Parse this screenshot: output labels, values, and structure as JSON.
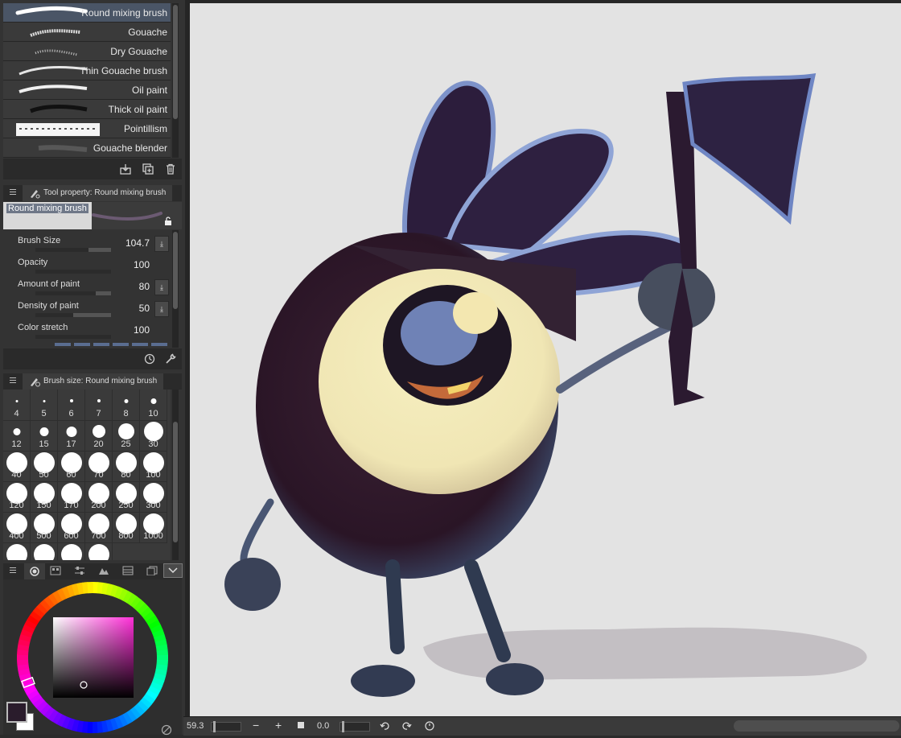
{
  "brushes": [
    {
      "label": "Round mixing brush",
      "selected": true
    },
    {
      "label": "Gouache",
      "selected": false
    },
    {
      "label": "Dry Gouache",
      "selected": false
    },
    {
      "label": "Thin Gouache brush",
      "selected": false
    },
    {
      "label": "Oil paint",
      "selected": false
    },
    {
      "label": "Thick oil paint",
      "selected": false
    },
    {
      "label": "Pointillism",
      "selected": false
    },
    {
      "label": "Gouache blender",
      "selected": false
    }
  ],
  "tool_property": {
    "tab_label": "Tool property: Round mixing brush",
    "preview_label": "Round mixing brush",
    "properties": [
      {
        "label": "Brush Size",
        "value": "104.7",
        "level": 0.7
      },
      {
        "label": "Opacity",
        "value": "100",
        "level": 1.0
      },
      {
        "label": "Amount of paint",
        "value": "80",
        "level": 0.8
      },
      {
        "label": "Density of paint",
        "value": "50",
        "level": 0.5
      },
      {
        "label": "Color stretch",
        "value": "100",
        "level": 1.0
      }
    ]
  },
  "brush_size": {
    "tab_label": "Brush size: Round mixing brush",
    "sizes": [
      "4",
      "5",
      "6",
      "7",
      "8",
      "10",
      "12",
      "15",
      "17",
      "20",
      "25",
      "30",
      "40",
      "50",
      "60",
      "70",
      "80",
      "100",
      "120",
      "150",
      "170",
      "200",
      "250",
      "300",
      "400",
      "500",
      "600",
      "700",
      "800",
      "1000",
      "",
      "",
      "",
      ""
    ]
  },
  "status": {
    "zoom": "59.3",
    "rotation": "0.0"
  },
  "colors": {
    "main": "#2a1c2c",
    "sub": "#ffffff",
    "picker_hue": "#ff2fd8"
  }
}
